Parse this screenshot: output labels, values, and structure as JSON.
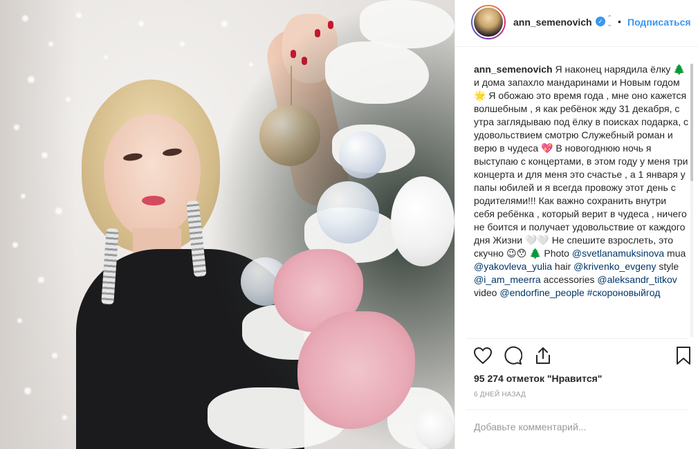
{
  "post": {
    "username": "ann_semenovich",
    "follow_label": "Подписаться",
    "separator": "•",
    "caption": {
      "author": "ann_semenovich",
      "text": "Я наконец нарядила ёлку 🌲 и дома запахло мандаринами и Новым годом 🌟 Я обожаю это время года , мне оно кажется волшебным , я как ребёнок жду 31 декабря, с утра заглядываю под ёлку в поисках подарка, с удовольствием смотрю Служебный роман и верю в чудеса 💖 В новогоднюю ночь я выступаю с концертами, в этом году у меня три концерта и для меня это счастье , а 1 января у папы юбилей и я всегда провожу этот день с родителями!!! Как важно сохранить внутри себя ребёнка , который верит в чудеса , ничего не боится и получает удовольствие от каждого дня Жизни 🤍🤍 Не спешите взрослеть, это скучно 😉😯 🌲 Photo",
      "mentions": [
        {
          "prefix": " ",
          "handle": "@svetlanamuksinova",
          "suffix": " mua "
        },
        {
          "prefix": "",
          "handle": "@yakovleva_yulia",
          "suffix": " hair "
        },
        {
          "prefix": "",
          "handle": "@krivenko_evgeny",
          "suffix": " style "
        },
        {
          "prefix": "",
          "handle": "@i_am_meerra",
          "suffix": " accessories "
        },
        {
          "prefix": "",
          "handle": "@aleksandr_titkov",
          "suffix": " video "
        },
        {
          "prefix": "",
          "handle": "@endorfine_people",
          "suffix": " "
        },
        {
          "prefix": "",
          "handle": "#скороновыйгод",
          "suffix": ""
        }
      ]
    },
    "likes_text": "95 274 отметок \"Нравится\"",
    "time_ago": "6 дней назад",
    "comment_placeholder": "Добавьте комментарий..."
  },
  "icons": {
    "like": "heart-outline-icon",
    "comment": "speech-bubble-icon",
    "share": "share-upload-icon",
    "save": "bookmark-icon",
    "verified": "verified-badge-icon"
  },
  "colors": {
    "link_blue": "#3897f0",
    "mention_blue": "#003569",
    "text": "#262626",
    "muted": "#999999",
    "divider": "#efefef"
  }
}
